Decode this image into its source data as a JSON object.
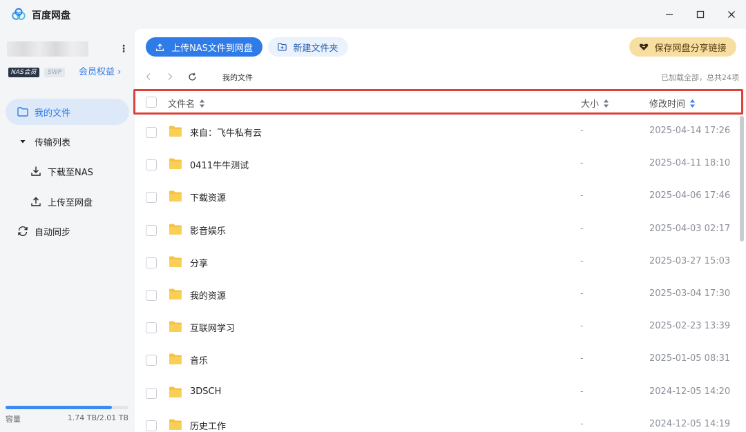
{
  "app": {
    "title": "百度网盘"
  },
  "sidebar": {
    "badges": {
      "nas": "NAS会员",
      "swp": "SWP"
    },
    "vip_link": "会员权益",
    "items": [
      {
        "label": "我的文件",
        "icon": "folder-icon",
        "active": true
      },
      {
        "label": "传输列表",
        "icon": "caret-down-icon",
        "active": false
      },
      {
        "label": "下载至NAS",
        "icon": "download-icon",
        "active": false
      },
      {
        "label": "上传至网盘",
        "icon": "upload-icon",
        "active": false
      },
      {
        "label": "自动同步",
        "icon": "sync-icon",
        "active": false
      }
    ],
    "storage": {
      "label": "容量",
      "value": "1.74 TB/2.01 TB",
      "used_fraction": 0.866
    }
  },
  "toolbar": {
    "upload_label": "上传NAS文件到网盘",
    "newfolder_label": "新建文件夹",
    "share_label": "保存网盘分享链接"
  },
  "navigation": {
    "breadcrumb": "我的文件",
    "loaded_info": "已加载全部，总共24项"
  },
  "table": {
    "columns": {
      "name": "文件名",
      "size": "大小",
      "modified": "修改时间"
    },
    "rows": [
      {
        "name": "来自：飞牛私有云",
        "size": "-",
        "modified": "2025-04-14 17:26"
      },
      {
        "name": "0411牛牛测试",
        "size": "-",
        "modified": "2025-04-11 18:10"
      },
      {
        "name": "下载资源",
        "size": "-",
        "modified": "2025-04-06 17:46"
      },
      {
        "name": "影音娱乐",
        "size": "-",
        "modified": "2025-04-03 02:17"
      },
      {
        "name": "分享",
        "size": "-",
        "modified": "2025-03-27 15:03"
      },
      {
        "name": "我的资源",
        "size": "-",
        "modified": "2025-03-04 17:30"
      },
      {
        "name": "互联网学习",
        "size": "-",
        "modified": "2025-02-23 13:39"
      },
      {
        "name": "音乐",
        "size": "-",
        "modified": "2025-01-05 08:31"
      },
      {
        "name": "3DSCH",
        "size": "-",
        "modified": "2024-12-05 14:20"
      },
      {
        "name": "历史工作",
        "size": "-",
        "modified": "2024-12-05 14:19"
      }
    ]
  },
  "colors": {
    "accent": "#2f7ce8",
    "highlight_border": "#e0403a",
    "folder": "#f7c244",
    "share_button": "#f7dfa2"
  }
}
